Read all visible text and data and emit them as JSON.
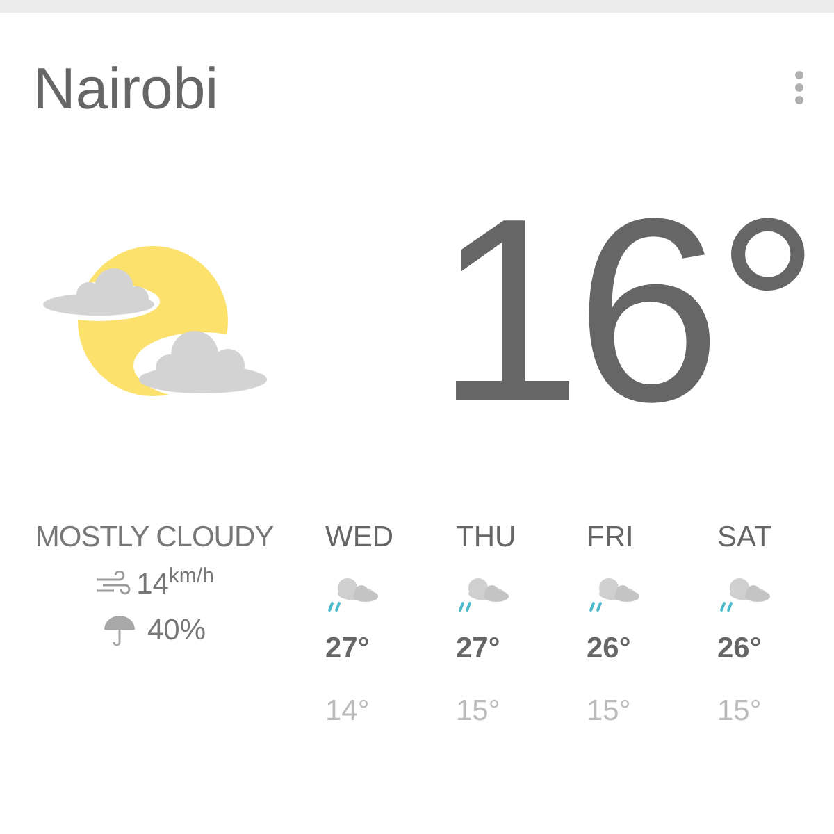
{
  "city": "Nairobi",
  "temperature": "16°",
  "condition": "MOSTLY CLOUDY",
  "wind": {
    "value": "14",
    "unit": "km/h"
  },
  "precipitation": "40%",
  "forecast": [
    {
      "day": "WED",
      "high": "27°",
      "low": "14°"
    },
    {
      "day": "THU",
      "high": "27°",
      "low": "15°"
    },
    {
      "day": "FRI",
      "high": "26°",
      "low": "15°"
    },
    {
      "day": "SAT",
      "high": "26°",
      "low": "15°"
    }
  ]
}
